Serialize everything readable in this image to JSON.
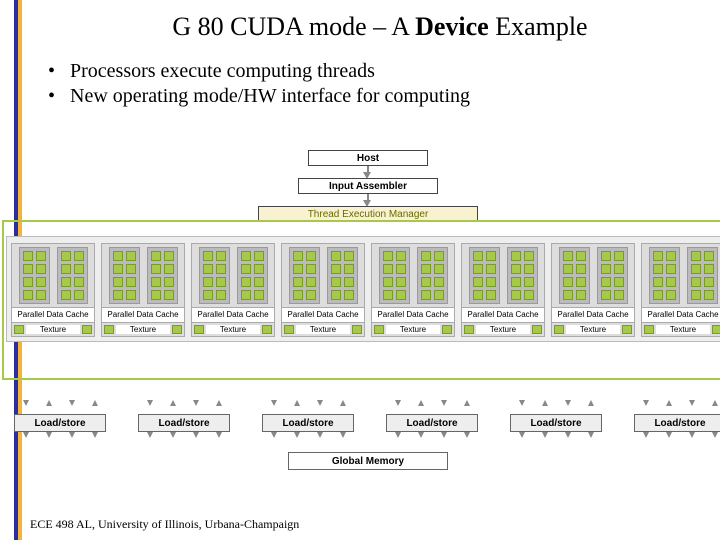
{
  "title": {
    "pre": "G 80 CUDA mode – A ",
    "bold": "Device",
    "post": " Example"
  },
  "bullets": [
    "Processors execute computing threads",
    "New operating mode/HW interface for computing"
  ],
  "diagram": {
    "host": "Host",
    "input_assembler": "Input Assembler",
    "tem": "Thread Execution Manager",
    "pdc": "Parallel Data Cache",
    "texture": "Texture",
    "load_store": "Load/store",
    "global_memory": "Global Memory",
    "sm_count": 8,
    "ls_count": 6
  },
  "footer": "ECE 498 AL, University of Illinois, Urbana-Champaign"
}
